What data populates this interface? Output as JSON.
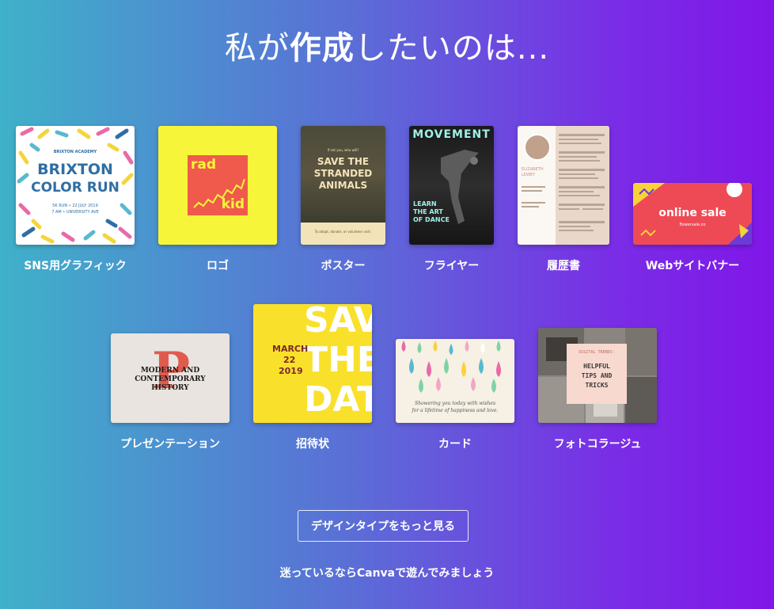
{
  "heading": {
    "part1": "私が",
    "part2": "作成",
    "part3": "したいのは..."
  },
  "design_types": [
    {
      "label": "SNS用グラフィック",
      "thumb": {
        "line1": "BRIXTON ACADEMY",
        "line2": "BRIXTON",
        "line3": "COLOR RUN",
        "line4": "5K RUN • 22 JULY 2019",
        "line5": "7 AM • UNIVERSITY AVE"
      }
    },
    {
      "label": "ロゴ",
      "thumb": {
        "word1": "rad",
        "word2": "kid"
      }
    },
    {
      "label": "ポスター",
      "thumb": {
        "small": "If not you, who will?",
        "line1": "SAVE THE",
        "line2": "STRANDED",
        "line3": "ANIMALS",
        "foot": "To adopt, donate, or volunteer visit:"
      }
    },
    {
      "label": "フライヤー",
      "thumb": {
        "title": "MOVEMENT",
        "line1": "LEARN",
        "line2": "THE ART",
        "line3": "OF DANCE"
      }
    },
    {
      "label": "履歴書",
      "thumb": {
        "name1": "ELIZABETH",
        "name2": "LEWEY"
      }
    },
    {
      "label": "Webサイトバナー",
      "thumb": {
        "text": "online sale",
        "sub": "flowersale.co"
      }
    },
    {
      "label": "プレゼンテーション",
      "thumb": {
        "letter": "P",
        "line1": "MODERN AND",
        "line2": "CONTEMPORARY",
        "line3": "HISTORY"
      }
    },
    {
      "label": "招待状",
      "thumb": {
        "big1": "SAVE",
        "big2": "THE",
        "big3": "DATE",
        "month": "MARCH",
        "day": "22",
        "year": "2019"
      }
    },
    {
      "label": "カード",
      "thumb": {
        "line1": "Showering you today with wishes",
        "line2": "for a lifetime of happiness and love."
      }
    },
    {
      "label": "フォトコラージュ",
      "thumb": {
        "small": "DIGITAL TRENDS:",
        "line1": "HELPFUL",
        "line2": "TIPS AND",
        "line3": "TRICKS"
      }
    }
  ],
  "more_button": "デザインタイプをもっと見る",
  "footer_text": "迷っているならCanvaで遊んでみましょう",
  "colors": {
    "gradient_start": "#3fb1c9",
    "gradient_end": "#8016e8",
    "logo_yellow": "#f7f53a",
    "logo_red": "#ef5a4c",
    "banner_red": "#ee4a55",
    "invite_yellow": "#f9e02b"
  }
}
